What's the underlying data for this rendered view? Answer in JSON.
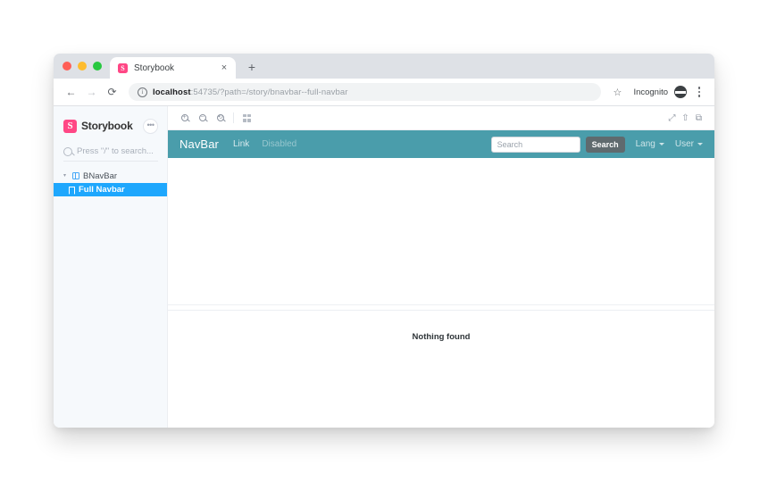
{
  "browser": {
    "tab": {
      "title": "Storybook",
      "favicon_letter": "S",
      "favicon_color": "#ff4785",
      "close_label": "×"
    },
    "new_tab_label": "+",
    "nav": {
      "back": "←",
      "forward": "→",
      "reload": "⟳"
    },
    "url": {
      "host": "localhost",
      "path": ":54735/?path=/story/bnavbar--full-navbar",
      "info_icon_label": "i"
    },
    "bookmark_star": "☆",
    "profile": {
      "label": "Incognito"
    },
    "traffic_lights": {
      "close": "#ff5f57",
      "minimize": "#febc2e",
      "maximize": "#28c840"
    }
  },
  "storybook": {
    "brand": {
      "name": "Storybook",
      "logo_letter": "S",
      "logo_color": "#ff4785",
      "menu_label": "•••"
    },
    "search": {
      "placeholder": "Press \"/\" to search..."
    },
    "tree": [
      {
        "label": "BNavBar",
        "icon": "component-icon",
        "caret": "▾",
        "selected": false
      },
      {
        "label": "Full Navbar",
        "icon": "story-icon",
        "selected": true
      }
    ],
    "selected_color": "#1ea7fd",
    "toolbar": {
      "zoom_in": "+",
      "zoom_out": "−",
      "zoom_reset": "⟲",
      "grid_label": "background-grid",
      "fullscreen_label": "⤢",
      "share_label": "⇧",
      "copy_label": "⧉"
    },
    "panel": {
      "nothing_found": "Nothing found"
    }
  },
  "story": {
    "navbar": {
      "background": "#4a9dab",
      "brand": "NavBar",
      "links": [
        {
          "label": "Link",
          "disabled": false
        },
        {
          "label": "Disabled",
          "disabled": true
        }
      ],
      "search": {
        "placeholder": "Search",
        "button_label": "Search",
        "button_color": "#5f6a6e"
      },
      "dropdowns": [
        {
          "label": "Lang"
        },
        {
          "label": "User"
        }
      ]
    }
  }
}
